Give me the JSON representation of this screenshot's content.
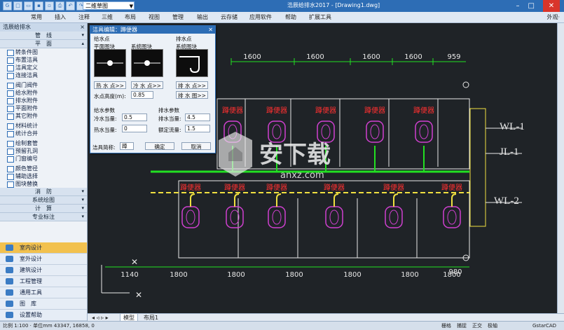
{
  "window": {
    "title": "浩辰给排水2017 - [Drawing1.dwg]",
    "view_selector": "二维草图",
    "buttons": [
      "–",
      "□",
      "✕"
    ]
  },
  "menu": {
    "items": [
      "常用",
      "插入",
      "注释",
      "三维",
      "布局",
      "视图",
      "管理",
      "输出",
      "云存储",
      "应用软件",
      "帮助",
      "扩展工具"
    ],
    "right": "外观·"
  },
  "left_panel": {
    "title": "浩辰给排水",
    "categories": {
      "pipe": "管　线",
      "plane": "平　面",
      "fire": "消　防",
      "system": "系统绘图",
      "calc": "计　算",
      "spec": "专业标注"
    },
    "tools_a": [
      "转条件图",
      "布置洁具",
      "洁具定义",
      "连接洁具"
    ],
    "tools_b": [
      "阀门阀件",
      "给水附件",
      "排水附件",
      "平面附件",
      "其它附件"
    ],
    "tools_c": [
      "材料统计",
      "统计合并"
    ],
    "tools_d": [
      "绘制套管",
      "预留孔洞",
      "门窗编号"
    ],
    "tools_e": [
      "颜色管径",
      "辅助选择",
      "图块替换"
    ],
    "nav": [
      "室内设计",
      "室外设计",
      "建筑设计",
      "工程管理",
      "通用工具",
      "图　库",
      "设置帮助"
    ]
  },
  "dialog": {
    "title": "洁具编辑：蹲便器",
    "water_supply_point": "给水点",
    "drain_point": "排水点",
    "plan_block": "平面图块",
    "system_block": "系统图块",
    "system_block2": "系统图块",
    "hot_water_btn": "热 水 点>>",
    "cold_water_btn": "冷 水 点>>",
    "drain_btn": "排 水 点>>",
    "drain_view_btn": "排 水 图>>",
    "height_label": "水点高度(m):",
    "height_value": "0.85",
    "supply_params": "给水参数",
    "drain_params": "排水参数",
    "cold_eq_label": "冷水当量:",
    "cold_eq_value": "0.5",
    "hot_eq_label": "热水当量:",
    "hot_eq_value": "0",
    "drain_eq_label": "排水当量:",
    "drain_eq_value": "4.5",
    "rated_flow_label": "额定流量:",
    "rated_flow_value": "1.5",
    "name_label": "洁具简称:",
    "name_value": "蹲",
    "ok": "确定",
    "cancel": "取消"
  },
  "cad": {
    "top_dims": [
      "1600",
      "1600",
      "1600",
      "1600",
      "959"
    ],
    "bottom_dims": [
      "1140",
      "1800",
      "1800",
      "1800",
      "1800",
      "1800",
      "1800",
      "980"
    ],
    "fixture_label": "蹲便器",
    "pipe_labels": [
      "WL-1",
      "JL-1",
      "WL-2"
    ],
    "colors": {
      "supply": "#22e022",
      "drain": "#f0e040",
      "fixture": "#d040d0",
      "label": "#ff3030",
      "line": "#e8e8e8"
    }
  },
  "watermark": {
    "text": "安下载",
    "sub": "anxz.com"
  },
  "tabs": [
    "模型",
    "布局1"
  ],
  "status": {
    "coords": "比例 1:100 · 单位mm  43347, 16858, 0",
    "right": [
      "栅格",
      "捕捉",
      "正交",
      "极轴",
      "GstarCAD"
    ]
  }
}
